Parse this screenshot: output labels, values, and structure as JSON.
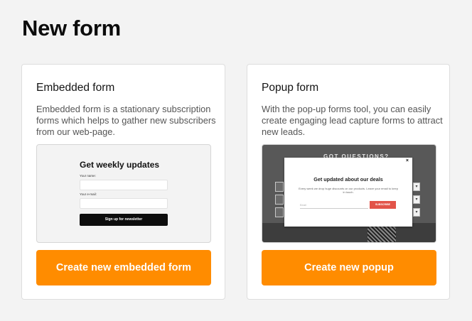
{
  "page": {
    "title": "New form"
  },
  "embedded": {
    "title": "Embedded form",
    "description": "Embedded form is a stationary subscription forms which helps to gather new subscribers from our web-page.",
    "preview": {
      "heading": "Get weekly updates",
      "name_label": "Your name:",
      "email_label": "Your e-mail:",
      "button": "Sign up for newsletter"
    },
    "cta": "Create new embedded form"
  },
  "popup": {
    "title": "Popup form",
    "description": "With the pop-up forms tool, you can easily create engaging lead capture forms to attract new leads.",
    "preview": {
      "background_heading": "GOT QUESTIONS?",
      "close": "×",
      "heading": "Get updated about our deals",
      "subtext": "Every week we drop huge discounts on our products. Leave your email to keep in touch.",
      "email_placeholder": "Email",
      "button": "SUBSCRIBE"
    },
    "cta": "Create new popup"
  },
  "colors": {
    "accent": "#ff8c00",
    "background": "#f3f3f3",
    "subscribe": "#e25449"
  }
}
